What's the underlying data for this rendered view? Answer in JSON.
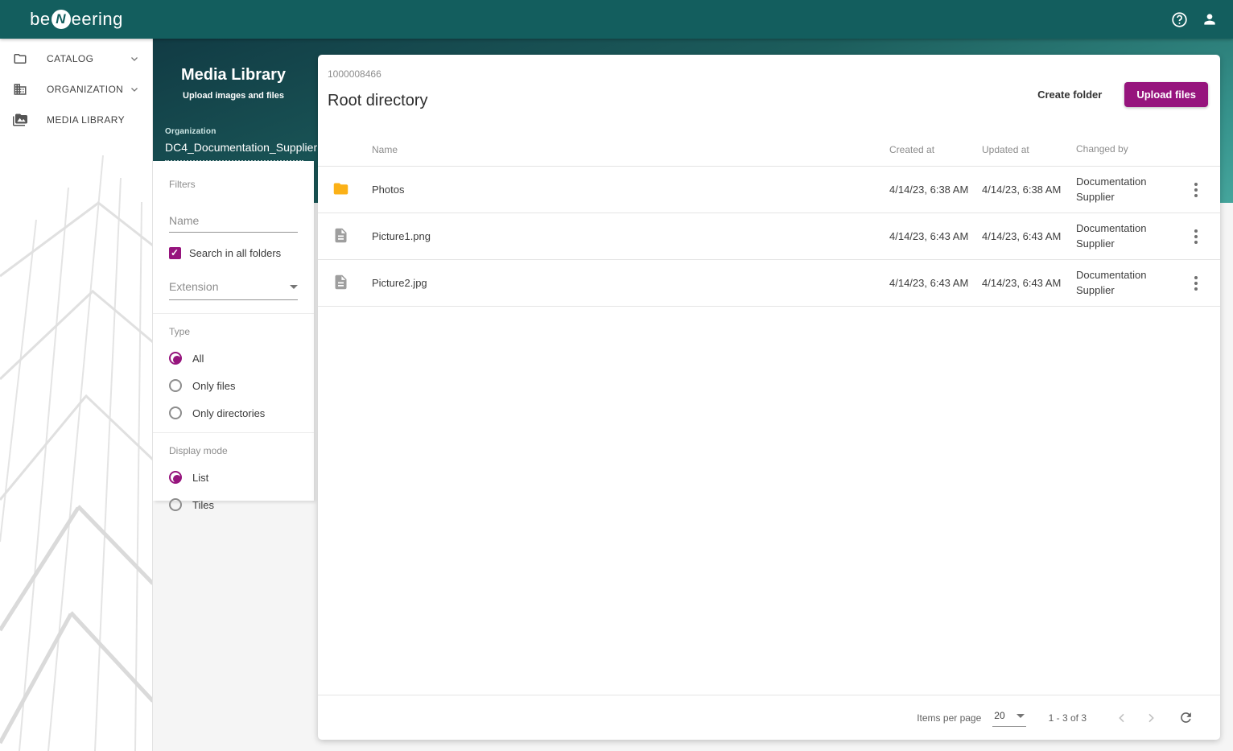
{
  "brand": {
    "logo_pre": "be",
    "logo_n": "N",
    "logo_post": "eering"
  },
  "topbar": {
    "icons": [
      "help-icon",
      "user-icon"
    ]
  },
  "sidebar": {
    "items": [
      {
        "label": "CATALOG",
        "icon": "folder-icon",
        "expandable": true
      },
      {
        "label": "ORGANIZATION",
        "icon": "organization-icon",
        "expandable": true
      },
      {
        "label": "MEDIA LIBRARY",
        "icon": "media-library-icon",
        "expandable": false
      }
    ]
  },
  "panel": {
    "title": "Media Library",
    "subtitle": "Upload images and files",
    "organization_label": "Organization",
    "organization_value": "DC4_Documentation_Supplier"
  },
  "filters": {
    "heading": "Filters",
    "name_placeholder": "Name",
    "search_all_label": "Search in all folders",
    "search_all_checked": true,
    "extension_label": "Extension",
    "type_heading": "Type",
    "type_options": [
      {
        "label": "All",
        "selected": true
      },
      {
        "label": "Only files",
        "selected": false
      },
      {
        "label": "Only directories",
        "selected": false
      }
    ],
    "display_heading": "Display mode",
    "display_options": [
      {
        "label": "List",
        "selected": true
      },
      {
        "label": "Tiles",
        "selected": false
      }
    ]
  },
  "content": {
    "id": "1000008466",
    "title": "Root directory",
    "create_folder_label": "Create folder",
    "upload_files_label": "Upload files",
    "table": {
      "columns": {
        "name": "Name",
        "created": "Created at",
        "updated": "Updated at",
        "changed": "Changed by"
      },
      "rows": [
        {
          "icon": "folder-row-icon",
          "name": "Photos",
          "created": "4/14/23, 6:38 AM",
          "updated": "4/14/23, 6:38 AM",
          "changed_by": "Documentation Supplier"
        },
        {
          "icon": "file-row-icon",
          "name": "Picture1.png",
          "created": "4/14/23, 6:43 AM",
          "updated": "4/14/23, 6:43 AM",
          "changed_by": "Documentation Supplier"
        },
        {
          "icon": "file-row-icon",
          "name": "Picture2.jpg",
          "created": "4/14/23, 6:43 AM",
          "updated": "4/14/23, 6:43 AM",
          "changed_by": "Documentation Supplier"
        }
      ]
    },
    "paginator": {
      "items_per_page_label": "Items per page",
      "items_per_page_value": "20",
      "range_label": "1 - 3 of 3"
    }
  },
  "colors": {
    "accent_magenta": "#96147d",
    "topbar_teal": "#135e5e",
    "gradient_dark": "#113b44",
    "gradient_light": "#45a59c",
    "folder_yellow": "#fbb117",
    "file_grey": "#9e9e9e",
    "page_background": "#f5f5f5"
  }
}
